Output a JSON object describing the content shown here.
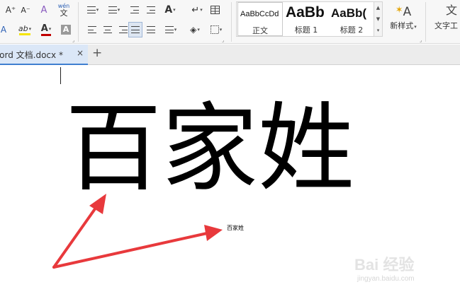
{
  "ribbon": {
    "font_grow_icon": "A⁺",
    "font_shrink_icon": "A⁻",
    "clear_format_icon": "A",
    "pinyin_top": "wén",
    "pinyin_bottom": "文",
    "bullets_icon": "bulleted-list-icon",
    "numbering_icon": "numbered-list-icon",
    "outdent_icon": "decrease-indent-icon",
    "indent_icon": "increase-indent-icon",
    "text_effect_label": "A",
    "table_icon": "table-icon",
    "highlight_label": "ab",
    "font_color_label": "A",
    "char_shade_label": "A",
    "styles": [
      {
        "sample": "AaBbCcDd",
        "name": "正文"
      },
      {
        "sample": "AaBb",
        "name": "标题 1"
      },
      {
        "sample": "AaBb(",
        "name": "标题 2"
      }
    ],
    "new_style_label": "新样式",
    "text_tools_label": "文字工",
    "text_tools_icon": "文"
  },
  "tabs": {
    "active_title": "Word 文档.docx *",
    "close_glyph": "×",
    "new_tab_glyph": "+"
  },
  "document": {
    "big_text": "百家姓",
    "small_text": "百家姓"
  },
  "watermark": {
    "main": "Bai 经验",
    "sub": "jingyan.baidu.com"
  },
  "colors": {
    "highlight": "#f5e400",
    "font_color": "#c00000",
    "arrow": "#e8393c",
    "tab_accent": "#3f7fd0"
  }
}
